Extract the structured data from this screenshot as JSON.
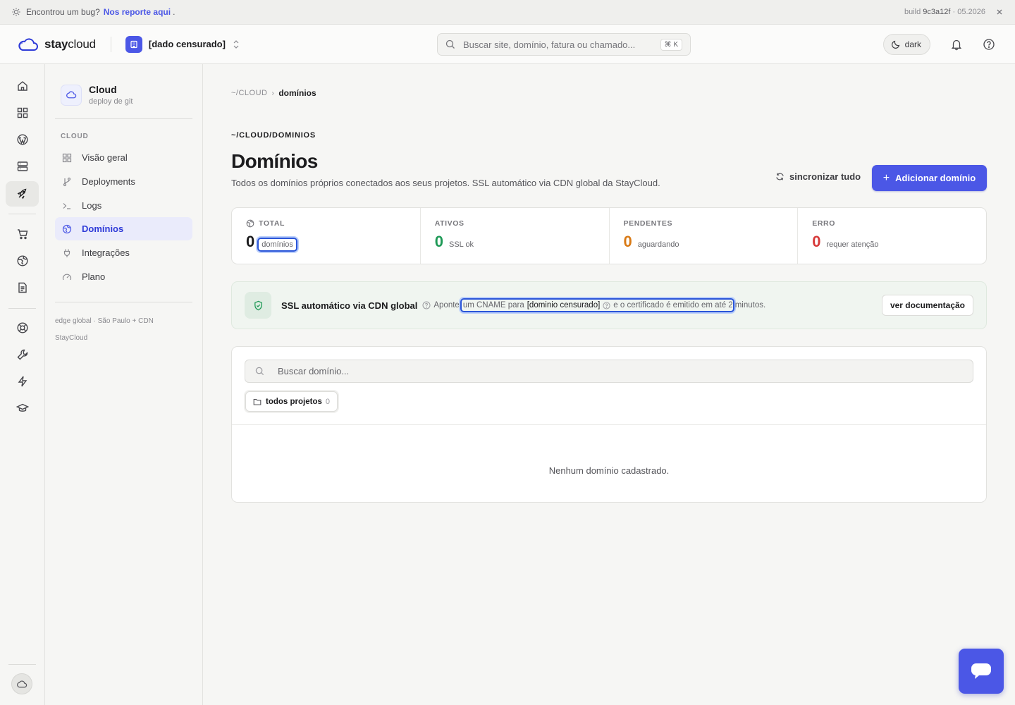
{
  "bugbar": {
    "text": "Encontrou um bug?",
    "link": "Nos reporte aqui",
    "dot": ".",
    "build_label": "build",
    "build_hash": "9c3a12f",
    "build_date": "· 05.2026"
  },
  "header": {
    "logo_part1": "stay",
    "logo_part2": "cloud",
    "org_name": "[dado censurado]",
    "search_placeholder": "Buscar site, domínio, fatura ou chamado...",
    "search_shortcut": "⌘ K",
    "theme_label": "dark"
  },
  "sidebar": {
    "title": "Cloud",
    "subtitle": "deploy de git",
    "section": "CLOUD",
    "items": [
      {
        "label": "Visão geral"
      },
      {
        "label": "Deployments"
      },
      {
        "label": "Logs"
      },
      {
        "label": "Domínios"
      },
      {
        "label": "Integrações"
      },
      {
        "label": "Plano"
      }
    ],
    "footer_line1": "edge global · São Paulo + CDN",
    "footer_line2": "StayCloud"
  },
  "main": {
    "breadcrumb_root": "~/CLOUD",
    "breadcrumb_sep": "›",
    "breadcrumb_current": "domínios",
    "path": "~/CLOUD/DOMINIOS",
    "title": "Domínios",
    "description": "Todos os domínios próprios conectados aos seus projetos. SSL automático via CDN global da StayCloud.",
    "sync_label": "sincronizar tudo",
    "add_label": "Adicionar domínio",
    "add_plus": "+",
    "stats": [
      {
        "label": "TOTAL",
        "value": "0",
        "unit": "domínios"
      },
      {
        "label": "ATIVOS",
        "value": "0",
        "unit": "SSL ok"
      },
      {
        "label": "PENDENTES",
        "value": "0",
        "unit": "aguardando"
      },
      {
        "label": "ERRO",
        "value": "0",
        "unit": "requer atenção"
      }
    ],
    "ssl": {
      "title": "SSL automático via CDN global",
      "text_before": "Aponte",
      "text_hl_start": "um CNAME para",
      "domain": "[dominio censurado]",
      "text_hl_end": "e o certificado é emitido em até 2",
      "text_after": "minutos.",
      "doc_label": "ver documentação"
    },
    "domain_search_placeholder": "Buscar domínio...",
    "filter_chip": {
      "label": "todos projetos",
      "count": "0"
    },
    "empty_state": "Nenhum domínio cadastrado."
  },
  "colors": {
    "accent": "#4b57e6",
    "success": "#1f9a57",
    "warning": "#d97a16",
    "error": "#d73a3a"
  }
}
